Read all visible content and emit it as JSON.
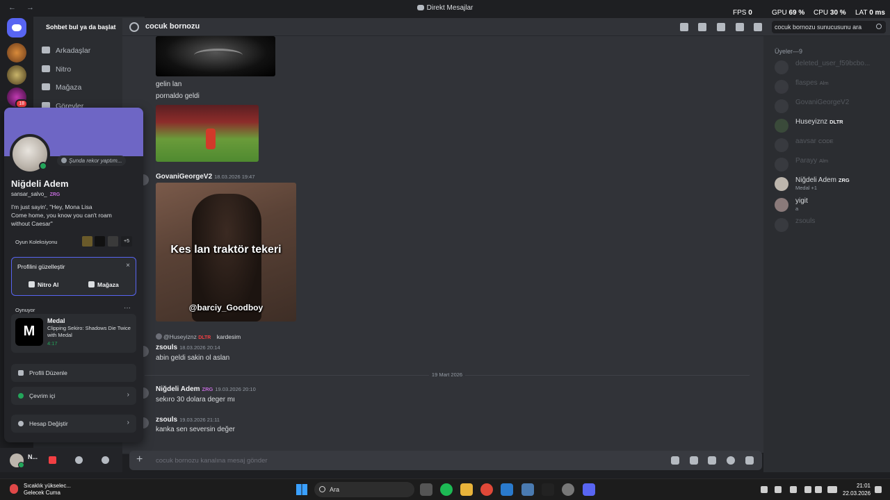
{
  "window": {
    "title": "Direkt Mesajlar",
    "nav": "← →"
  },
  "hud": {
    "fps_label": "FPS",
    "fps": "0",
    "gpu_label": "GPU",
    "gpu": "69 %",
    "cpu_label": "CPU",
    "cpu": "30 %",
    "lat_label": "LAT",
    "lat": "0 ms"
  },
  "servers": [
    {
      "badge": "18"
    }
  ],
  "channels": {
    "search": "Sohbet bul ya da başlat",
    "items": [
      {
        "label": "Arkadaşlar"
      },
      {
        "label": "Nitro"
      },
      {
        "label": "Mağaza"
      },
      {
        "label": "Görevler"
      }
    ]
  },
  "header": {
    "name": "cocuk bornozu",
    "search_placeholder": "cocuk bornozu sunucusunu ara"
  },
  "messages": {
    "m1": "gelin lan",
    "m2": "pornaldo geldi",
    "a1": {
      "author": "GovaniGeorgeV2",
      "ts": "18.03.2026 19:47"
    },
    "img3_caption1": "Kes lan traktör tekeri",
    "img3_caption2": "@barciy_Goodboy",
    "reply": {
      "user": "@Huseyiznz",
      "tag": "DLTR",
      "text": "kardesim"
    },
    "a2": {
      "author": "zsouls",
      "ts": "18.03.2026 20:14",
      "text": "abin geldi sakin ol aslan"
    },
    "divider": "19 Mart 2026",
    "a3": {
      "author": "Niğdeli Adem",
      "tag": "ZRG",
      "ts": "19.03.2026 20:10",
      "text": "sekıro 30 dolara deger mı"
    },
    "a4": {
      "author": "zsouls",
      "ts": "19.03.2026 21:11",
      "text": "kanka sen seversin değer"
    }
  },
  "composer": {
    "plus": "+",
    "placeholder": "cocuk bornozu kanalına mesaj gönder"
  },
  "members": {
    "header": "Üyeler—9",
    "list": [
      {
        "name": "deleted_user_f59bcbo...",
        "tag": "",
        "sub": ""
      },
      {
        "name": "flaspes",
        "tag": "Alm",
        "sub": ""
      },
      {
        "name": "GovaniGeorgeV2",
        "tag": "",
        "sub": ""
      },
      {
        "name": "Huseyiznz",
        "tag": "DLTR",
        "sub": ""
      },
      {
        "name": "aavsar",
        "tag": "CODE",
        "sub": ""
      },
      {
        "name": "Parayy",
        "tag": "Alm",
        "sub": ""
      },
      {
        "name": "Niğdeli Adem",
        "tag": "ZRG",
        "sub": "Medal +1"
      },
      {
        "name": "yigit",
        "tag": "",
        "sub": "a"
      },
      {
        "name": "zsouls",
        "tag": "",
        "sub": ""
      }
    ]
  },
  "profile": {
    "status": "Şunda rekor yaptım...",
    "name": "Niğdeli Adem",
    "username": "sansar_salvo_",
    "tag": "ZRG",
    "bio": "I'm just sayin', \"Hey, Mona Lisa\nCome home, you know you can't roam\nwithout Caesar\"",
    "games_label": "Oyun Koleksiyonu",
    "games_more": "+5",
    "customize": {
      "title": "Profilini güzelleştir",
      "close": "×",
      "nitro": "Nitro Al",
      "shop": "Mağaza"
    },
    "playing_label": "Oynuyor",
    "playing_more": "···",
    "activity": {
      "name": "Medal",
      "detail": "Clipping Sekiro: Shadows Die Twice with Medal",
      "time": "4:17"
    },
    "menu": [
      {
        "label": "Profili Düzenle",
        "chevron": ""
      },
      {
        "label": "Çevrim içi",
        "chevron": "›"
      },
      {
        "label": "Hesap Değiştir",
        "chevron": "›"
      }
    ]
  },
  "userbar": {
    "name": "N..."
  },
  "taskbar": {
    "weather_line1": "Sıcaklık yükselec...",
    "weather_line2": "Gelecek Cuma",
    "search": "Ara",
    "time": "21:01",
    "date": "22.03.2026"
  }
}
